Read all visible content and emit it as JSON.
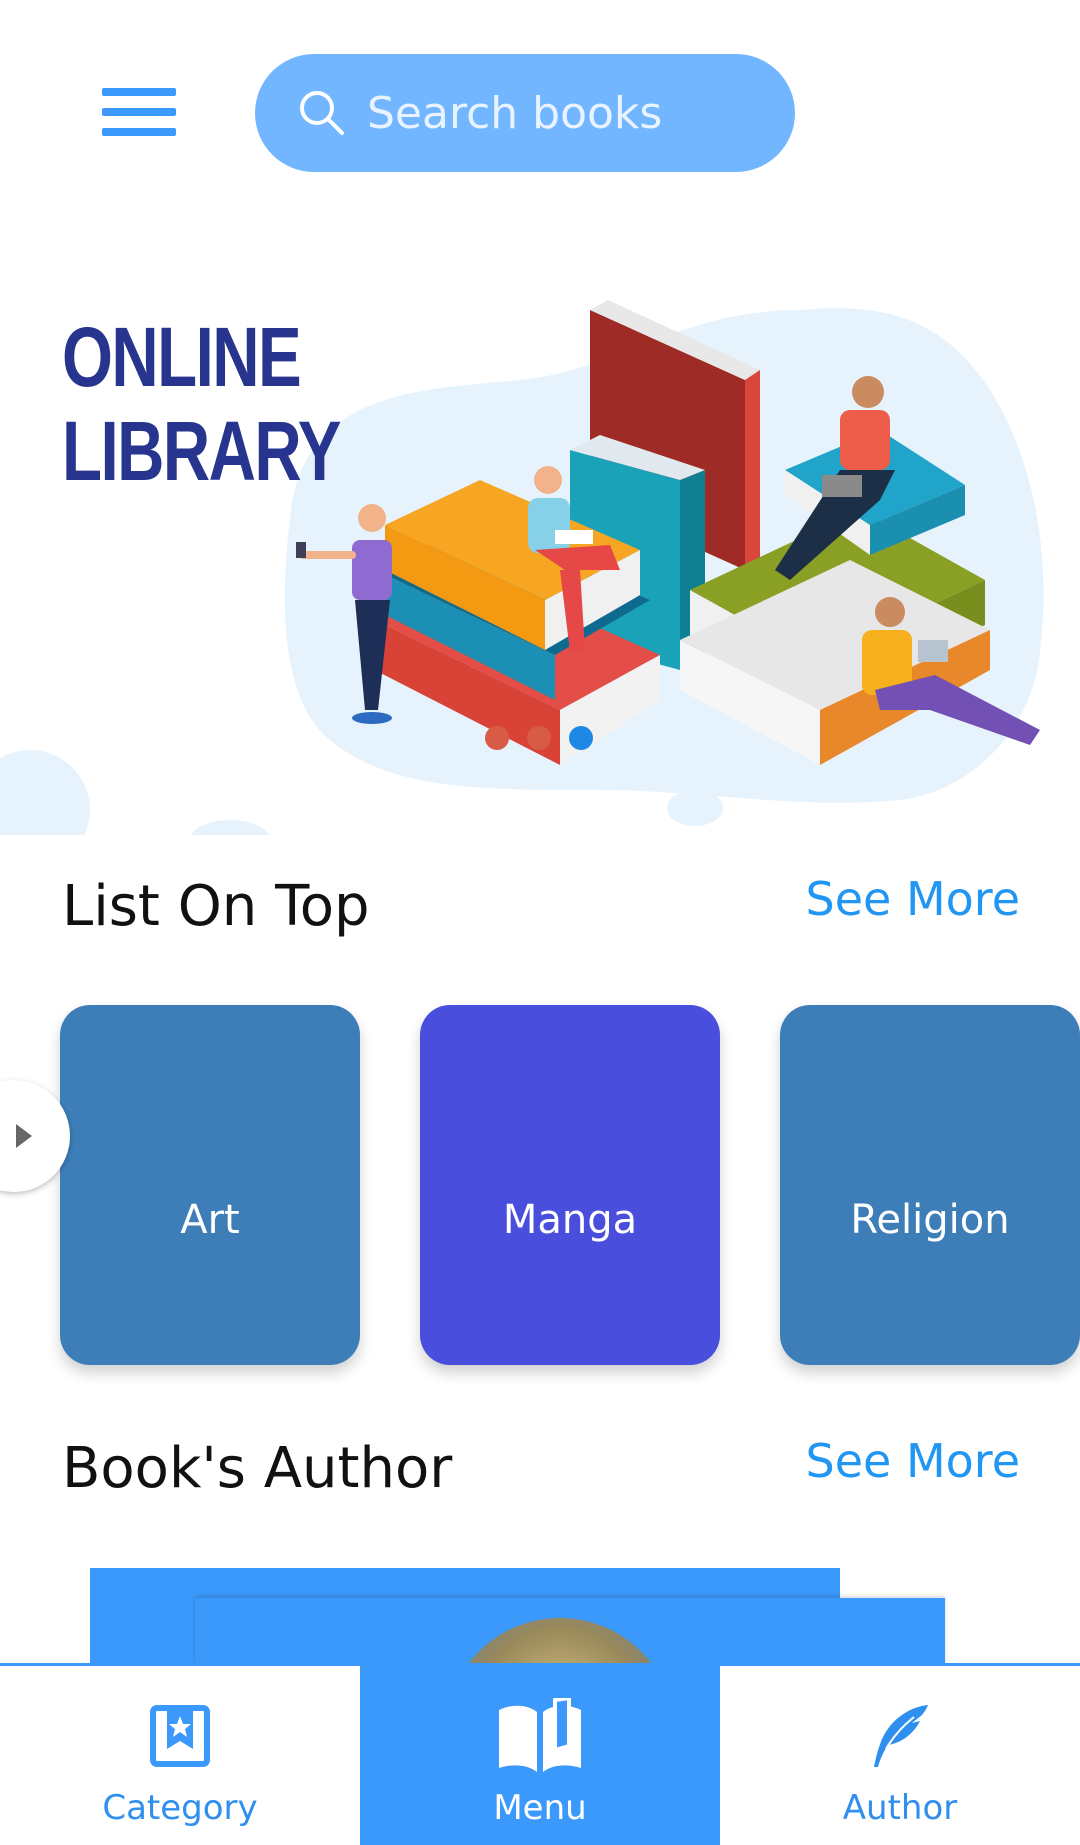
{
  "header": {
    "search_placeholder": "Search books"
  },
  "banner": {
    "title_line1": "ONLINE",
    "title_line2": "LIBRARY",
    "carousel_total": 3,
    "carousel_active": 3
  },
  "list_on_top": {
    "title": "List On Top",
    "see_more": "See More",
    "cards": [
      {
        "label": "Art",
        "color": "#3d7eb8"
      },
      {
        "label": "Manga",
        "color": "#4a4edc"
      },
      {
        "label": "Religion",
        "color": "#3d7eb8"
      }
    ]
  },
  "authors": {
    "title": "Book's Author",
    "see_more": "See More"
  },
  "bottom_nav": {
    "items": [
      {
        "label": "Category",
        "icon": "bookmark-star-icon",
        "active": false
      },
      {
        "label": "Menu",
        "icon": "open-book-icon",
        "active": true
      },
      {
        "label": "Author",
        "icon": "quill-icon",
        "active": false
      }
    ]
  },
  "colors": {
    "accent": "#3b99fb",
    "search_bg": "#72b6ff",
    "title_navy": "#27358f",
    "link": "#2196f3"
  }
}
